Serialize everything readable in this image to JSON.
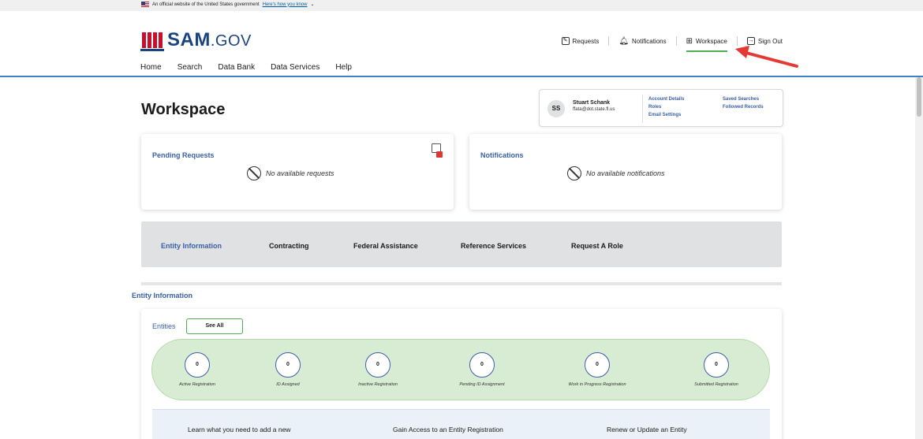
{
  "banner": {
    "text": "An official website of the United States government",
    "link": "Here's how you know"
  },
  "logo": {
    "brand": "SAM",
    "suffix": ".GOV"
  },
  "top_links": {
    "requests": "Requests",
    "notifications": "Notifications",
    "workspace": "Workspace",
    "sign_out": "Sign Out"
  },
  "nav": [
    "Home",
    "Search",
    "Data Bank",
    "Data Services",
    "Help"
  ],
  "page_title": "Workspace",
  "profile": {
    "initials": "SS",
    "name": "Stuart Schank",
    "email": "ffata@dot.state.fl.us",
    "links_col1": [
      "Account Details",
      "Roles",
      "Email Settings"
    ],
    "links_col2": [
      "Saved Searches",
      "Followed Records"
    ]
  },
  "pending": {
    "title": "Pending Requests",
    "empty": "No available requests"
  },
  "notifications": {
    "title": "Notifications",
    "empty": "No available notifications"
  },
  "tabs": [
    "Entity Information",
    "Contracting",
    "Federal Assistance",
    "Reference Services",
    "Request A Role"
  ],
  "section_title": "Entity Information",
  "entities": {
    "label": "Entities",
    "see_all": "See All",
    "stats": [
      {
        "value": "0",
        "label": "Active Registration"
      },
      {
        "value": "0",
        "label": "ID Assigned"
      },
      {
        "value": "0",
        "label": "Inactive Registration"
      },
      {
        "value": "0",
        "label": "Pending ID Assignment"
      },
      {
        "value": "0",
        "label": "Work in Progress Registration"
      },
      {
        "value": "0",
        "label": "Submitted Registration"
      }
    ]
  },
  "learn": [
    "Learn what you need to add a new",
    "Gain Access to an Entity Registration",
    "Renew or Update an Entity"
  ],
  "colors": {
    "primary": "#3a5fa8",
    "accent": "#4caf50",
    "brand_red": "#c8102e",
    "annotation": "#e53935"
  }
}
